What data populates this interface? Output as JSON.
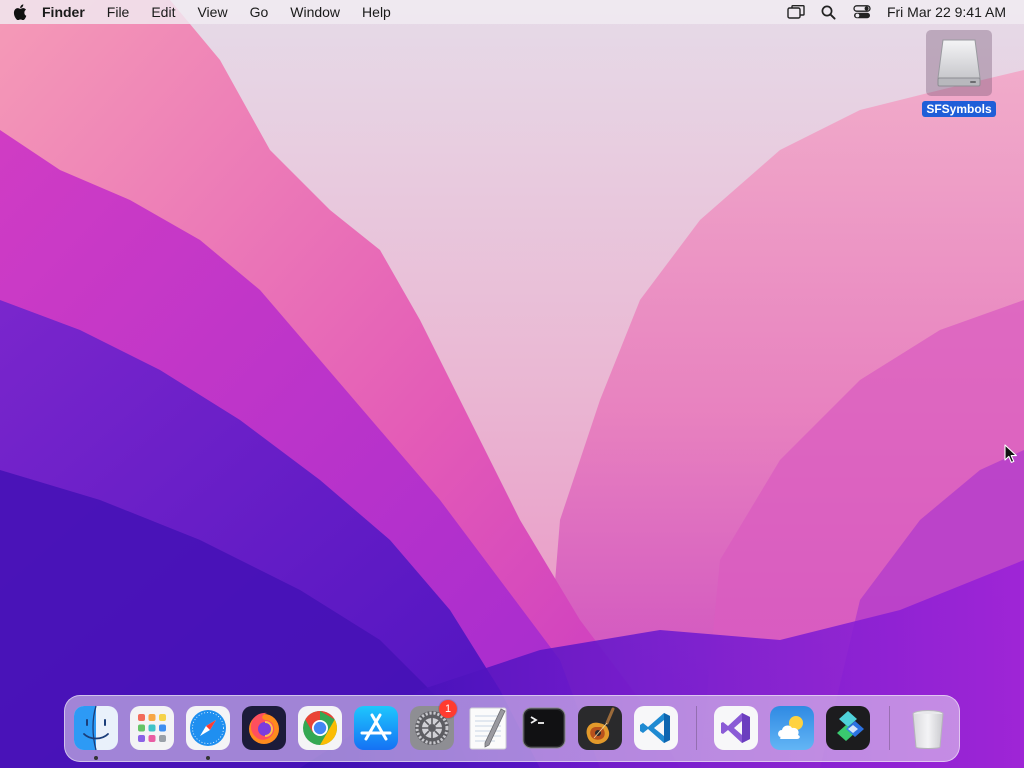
{
  "menubar": {
    "apple_icon": "apple-logo-icon",
    "app_name": "Finder",
    "menus": [
      "File",
      "Edit",
      "View",
      "Go",
      "Window",
      "Help"
    ],
    "status_icons": [
      "screen-mirroring-icon",
      "spotlight-search-icon",
      "control-center-icon"
    ],
    "clock": "Fri Mar 22  9:41 AM"
  },
  "desktop": {
    "items": [
      {
        "label": "SFSymbols",
        "icon": "external-drive-icon",
        "selected": true
      }
    ]
  },
  "dock": {
    "apps": [
      {
        "name": "Finder",
        "icon": "finder-icon",
        "running": true
      },
      {
        "name": "Launchpad",
        "icon": "launchpad-icon",
        "running": false
      },
      {
        "name": "Safari",
        "icon": "safari-icon",
        "running": true
      },
      {
        "name": "Firefox",
        "icon": "firefox-icon",
        "running": false
      },
      {
        "name": "Google Chrome",
        "icon": "chrome-icon",
        "running": false
      },
      {
        "name": "App Store",
        "icon": "app-store-icon",
        "running": false
      },
      {
        "name": "System Settings",
        "icon": "system-settings-icon",
        "running": false,
        "badge": "1"
      },
      {
        "name": "TextEdit",
        "icon": "textedit-icon",
        "running": false
      },
      {
        "name": "Terminal",
        "icon": "terminal-icon",
        "running": false
      },
      {
        "name": "GarageBand",
        "icon": "garageband-icon",
        "running": false
      },
      {
        "name": "Visual Studio Code",
        "icon": "vscode-icon",
        "running": false
      }
    ],
    "recent_apps": [
      {
        "name": "Visual Studio",
        "icon": "visual-studio-icon"
      },
      {
        "name": "Weather",
        "icon": "weather-icon"
      },
      {
        "name": "Shortcuts",
        "icon": "shortcuts-icon"
      }
    ],
    "trash": {
      "name": "Trash",
      "icon": "trash-icon"
    }
  },
  "colors": {
    "menubar_bg": "#F0ECF2",
    "selection_blue": "#1F5ED8",
    "badge_red": "#FF3B30"
  }
}
